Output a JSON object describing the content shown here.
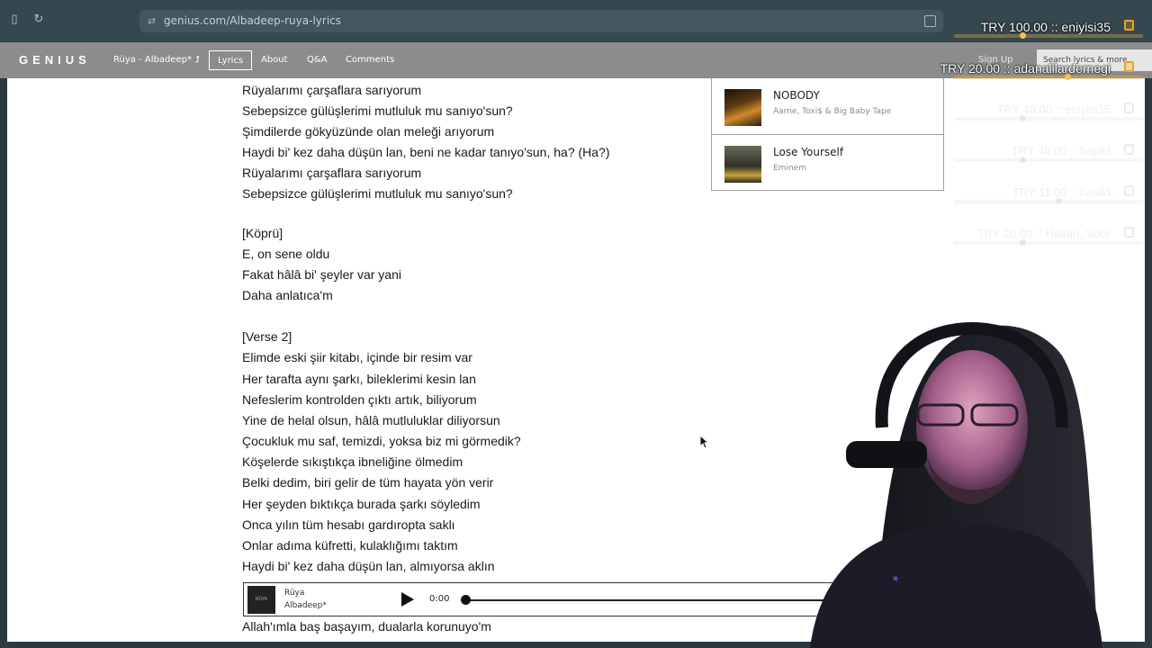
{
  "browser": {
    "url": "genius.com/Albadeep-ruya-lyrics"
  },
  "header": {
    "logo": "GENIUS",
    "song_title": "Rüya - Albadeep* ⮥",
    "nav": [
      "Lyrics",
      "About",
      "Q&A",
      "Comments"
    ],
    "active_nav": "Lyrics",
    "sign_up": "Sign Up",
    "search_placeholder": "Search lyrics & more"
  },
  "lyrics": [
    "Rüyalarımı çarşaflara sarıyorum",
    "Sebepsizce gülüşlerimi mutluluk mu sanıyo'sun?",
    "Şimdilerde gökyüzünde olan meleği arıyorum",
    "Haydi bi' kez daha düşün lan, beni ne kadar tanıyo'sun, ha? (Ha?)",
    "Rüyalarımı çarşaflara sarıyorum",
    "Sebepsizce gülüşlerimi mutluluk mu sanıyo'sun?",
    "",
    "[Köprü]",
    "E, on sene oldu",
    "Fakat hâlâ bi' şeyler var yani",
    "Daha anlatıca'm",
    "",
    "[Verse 2]",
    "Elimde eski şiir kitabı, içinde bir resim var",
    "Her tarafta aynı şarkı, bileklerimi kesin lan",
    "Nefeslerim kontrolden çıktı artık, biliyorum",
    "Yine de helal olsun, hâlâ mutluluklar diliyorsun",
    "Çocukluk mu saf, temizdi, yoksa biz mi görmedik?",
    "Köşelerde sıkıştıkça ibneliğine ölmedim",
    "Belki dedim, biri gelir de tüm hayata yön verir",
    "Her şeyden bıktıkça burada şarkı söyledim",
    "Onca yılın tüm hesabı gardıropta saklı",
    "Onlar adıma küfretti, kulaklığımı taktım",
    "Haydi bi' kez daha düşün lan, almıyorsa aklın",
    "",
    "Allah'ımla baş başayım, dualarla korunuyo'm"
  ],
  "recommendations": [
    {
      "title": "NOBODY",
      "artist": "Aarne, Toxi$ & Big Baby Tape"
    },
    {
      "title": "Lose Yourself",
      "artist": "Eminem"
    }
  ],
  "player": {
    "title": "Rüya",
    "artist": "Albadeep*",
    "cover_text": "RÜYA",
    "time": "0:00",
    "progress": 0
  },
  "donations": {
    "top": [
      "TRY 100.00 :: eniyisi35",
      "TRY 20.00 :: adanalilardernegi"
    ],
    "faded": [
      "TRY 40.00 :: eniyisi35",
      "TRY 40.00 :: hayikt",
      "TRY 11.00 :: hayikt",
      "TRY 20.00 :: Hakan_Sbor"
    ]
  },
  "colors": {
    "accent": "#f2a31b",
    "header_bg": "#8c8c8c",
    "chrome_bg": "#354850"
  }
}
